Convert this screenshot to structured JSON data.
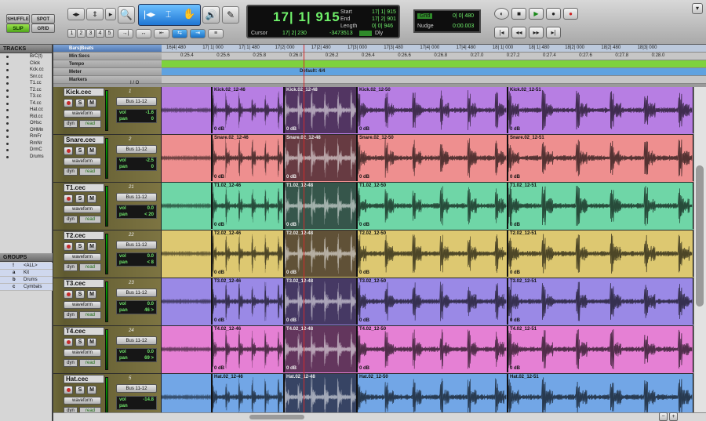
{
  "modes": {
    "shuffle": "SHUFFLE",
    "spot": "SPOT",
    "slip": "SLIP",
    "grid": "GRID"
  },
  "toolbar": {
    "zoom_presets": [
      "1",
      "2",
      "3",
      "4",
      "5"
    ]
  },
  "counter": {
    "main": "17| 1| 915",
    "cursor_label": "Cursor",
    "cursor_value": "17| 2| 230",
    "start_label": "Start",
    "start_value": "17| 1| 915",
    "end_label": "End",
    "end_value": "17| 2| 901",
    "length_label": "Length",
    "length_value": "0| 0| 946",
    "sample_value": "-3473513",
    "dly_label": "Dly"
  },
  "grid": {
    "label": "Grid",
    "value": "0| 0| 480",
    "nudge_label": "Nudge",
    "nudge_value": "0:00.003"
  },
  "tracks_panel": {
    "title": "TRACKS",
    "items": [
      "BrC(t)",
      "Click",
      "Kck.cc",
      "Snr.cc",
      "T1.cc",
      "T2.cc",
      "T3.cc",
      "T4.cc",
      "Hat.cc",
      "Rid.cc",
      "OHsc",
      "OHMn",
      "RmFr",
      "RmNr",
      "DrmC",
      "Drums"
    ]
  },
  "groups_panel": {
    "title": "GROUPS",
    "items": [
      {
        "letter": "!",
        "name": "<ALL>"
      },
      {
        "letter": "a",
        "name": "Kit"
      },
      {
        "letter": "b",
        "name": "Drums"
      },
      {
        "letter": "c",
        "name": "Cymbals"
      }
    ]
  },
  "ruler": {
    "rows": [
      "Bars|Beats",
      "Min:Secs",
      "Tempo",
      "Meter",
      "Markers"
    ],
    "bars": [
      "16|4| 480",
      "17| 1| 000",
      "17| 1| 480",
      "17|2| 000",
      "17|2| 480",
      "17|3| 000",
      "17|3| 480",
      "17|4| 000",
      "17|4| 480",
      "18| 1| 000",
      "18| 1| 480",
      "18|2| 000",
      "18|2| 480",
      "18|3| 000"
    ],
    "secs": [
      "0:25.4",
      "0:25.6",
      "0:25.8",
      "0:26.0",
      "0:26.2",
      "0:26.4",
      "0:26.6",
      "0:26.8",
      "0:27.0",
      "0:27.2",
      "0:27.4",
      "0:27.6",
      "0:27.8",
      "0:28.0"
    ],
    "meter_text": "Default: 4/4"
  },
  "list_header": {
    "io": "I / O"
  },
  "tracks": [
    {
      "name": "Kick.cec",
      "num": "1",
      "bus": "Bus 11-12",
      "vol": "-1.6",
      "pan": "0",
      "view": "waveform",
      "dyn": "dyn",
      "mode": "read",
      "color": "#b77ee3",
      "clips": [
        "Kick.02_12-46",
        "Kick.02_12-48",
        "Kick.02_12-50",
        "Kick.02_12-51"
      ],
      "gain": "0 dB"
    },
    {
      "name": "Snare.cec",
      "num": "2",
      "bus": "Bus 11-12",
      "vol": "-2.5",
      "pan": "0",
      "view": "waveform",
      "dyn": "dyn",
      "mode": "read",
      "color": "#ee8f8f",
      "clips": [
        "Snare.02_12-46",
        "Snare.02_12-48",
        "Snare.02_12-50",
        "Snare.02_12-51"
      ],
      "gain": "0 dB"
    },
    {
      "name": "T1.cec",
      "num": "21",
      "bus": "Bus 11-12",
      "vol": "0.0",
      "pan": "< 20",
      "view": "waveform",
      "dyn": "dyn",
      "mode": "read",
      "color": "#6fd6a7",
      "clips": [
        "T1.02_12-46",
        "T1.02_12-48",
        "T1.02_12-50",
        "T1.02_12-51"
      ],
      "gain": "0 dB"
    },
    {
      "name": "T2.cec",
      "num": "22",
      "bus": "Bus 11-12",
      "vol": "0.0",
      "pan": "< 8",
      "view": "waveform",
      "dyn": "dyn",
      "mode": "read",
      "color": "#ddc871",
      "clips": [
        "T2.02_12-46",
        "T2.02_12-48",
        "T2.02_12-50",
        "T2.02_12-51"
      ],
      "gain": "0 dB"
    },
    {
      "name": "T3.cec",
      "num": "23",
      "bus": "Bus 11-12",
      "vol": "0.0",
      "pan": "46 >",
      "view": "waveform",
      "dyn": "dyn",
      "mode": "read",
      "color": "#9a89e6",
      "clips": [
        "T3.02_12-46",
        "T3.02_12-48",
        "T3.02_12-50",
        "T3.02_12-51"
      ],
      "gain": "0 dB"
    },
    {
      "name": "T4.cec",
      "num": "24",
      "bus": "Bus 11-12",
      "vol": "0.0",
      "pan": "69 >",
      "view": "waveform",
      "dyn": "dyn",
      "mode": "read",
      "color": "#e580d4",
      "clips": [
        "T4.02_12-46",
        "T4.02_12-48",
        "T4.02_12-50",
        "T4.02_12-51"
      ],
      "gain": "0 dB"
    },
    {
      "name": "Hat.cec",
      "num": "5",
      "bus": "Bus 11-12",
      "vol": "-14.8",
      "pan": "",
      "view": "waveform",
      "dyn": "dyn",
      "mode": "read",
      "color": "#72a6e6",
      "clips": [
        "Hat.02_12-46",
        "Hat.02_12-48",
        "Hat.02_12-50",
        "Hat.02_12-51"
      ],
      "gain": ""
    }
  ],
  "colors": {
    "toolbar_bg": "#c0c0c0",
    "counter_text": "#6ff06a",
    "selection": "#2a1f2a",
    "playhead": "#d42a2a"
  }
}
